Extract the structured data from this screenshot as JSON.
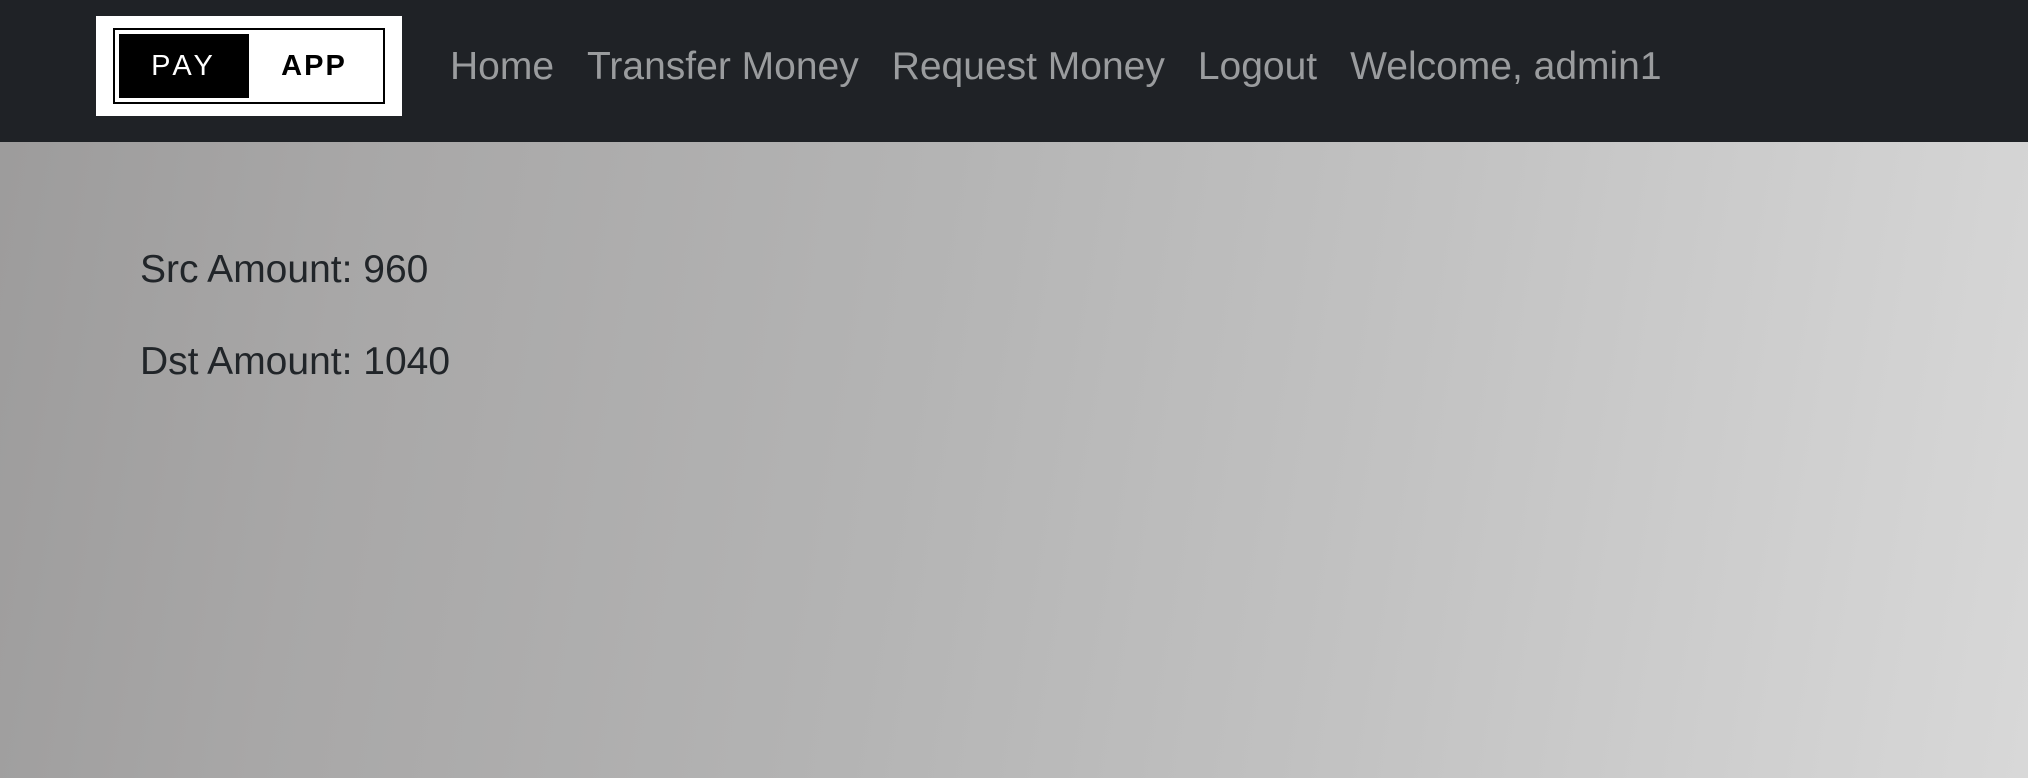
{
  "brand": {
    "left_text": "PAY",
    "right_text": "APP"
  },
  "nav": {
    "items": [
      {
        "label": "Home"
      },
      {
        "label": "Transfer Money"
      },
      {
        "label": "Request Money"
      },
      {
        "label": "Logout"
      }
    ],
    "welcome": "Welcome, admin1"
  },
  "main": {
    "src_amount": "Src Amount: 960",
    "dst_amount": "Dst Amount: 1040"
  },
  "colors": {
    "navbar_bg": "#1f2226",
    "nav_link": "#9a9c9e",
    "body_text": "#212529"
  }
}
